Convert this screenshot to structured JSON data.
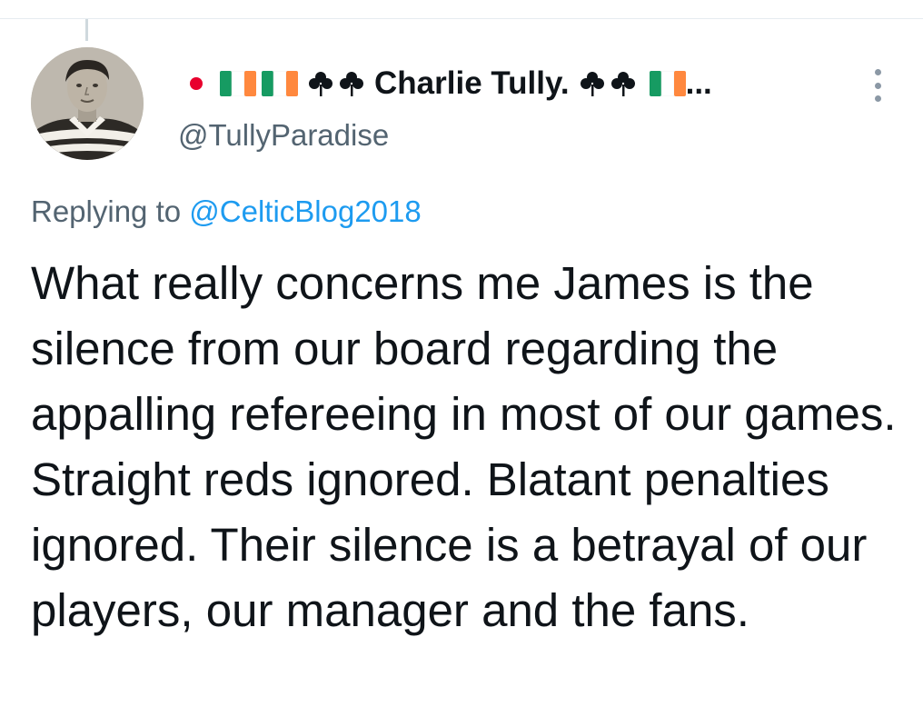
{
  "author": {
    "display_name": "Charlie Tully.",
    "handle": "@TullyParadise",
    "name_suffix": "...",
    "avatar_icon": "vintage-player-photo",
    "prefix_emojis": [
      "japan-flag-icon",
      "ireland-flag-icon",
      "ireland-flag-icon",
      "shamrock-icon",
      "shamrock-icon"
    ],
    "suffix_emojis": [
      "shamrock-icon",
      "shamrock-icon",
      "ireland-flag-icon"
    ]
  },
  "reply": {
    "prefix": "Replying to ",
    "mention": "@CelticBlog2018"
  },
  "tweet": {
    "text": "What really concerns me James is the silence from our board regarding the appalling refereeing in most of our games. Straight reds ignored. Blatant penalties ignored. Their silence is a betrayal of our players, our manager and the fans."
  },
  "colors": {
    "text": "#0f1419",
    "secondary": "#536471",
    "link": "#1d9bf0",
    "irish_green": "#169b62",
    "irish_orange": "#ff883e",
    "japan_red": "#e8002d"
  }
}
